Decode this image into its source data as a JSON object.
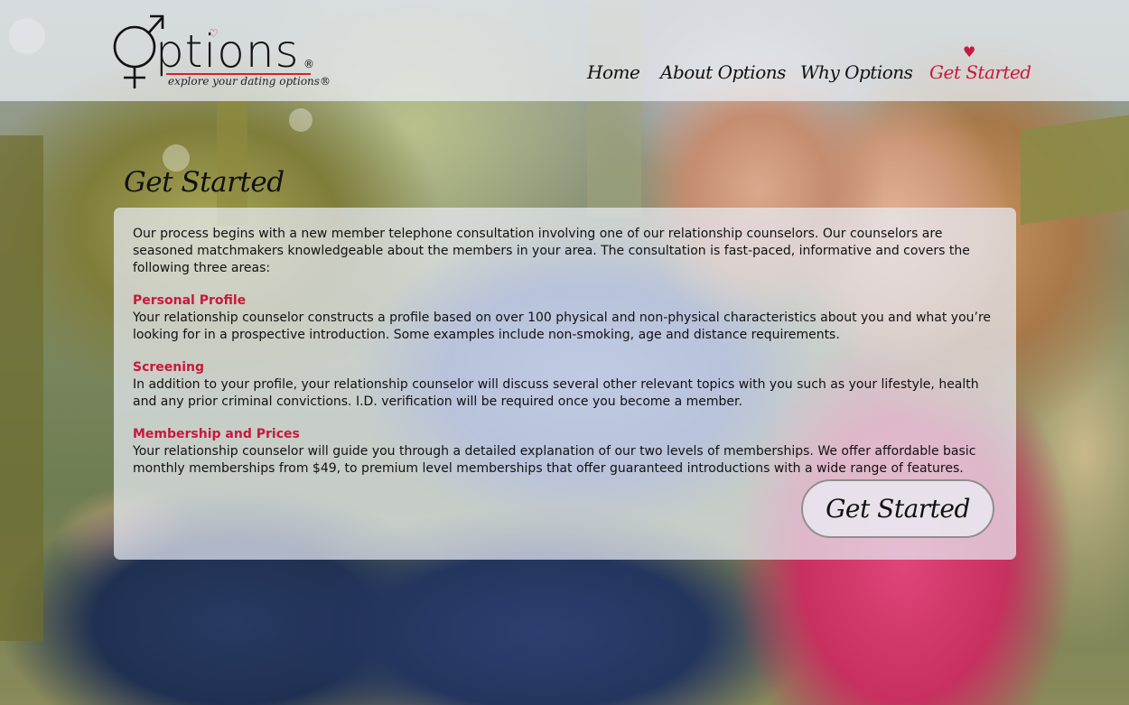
{
  "brand": {
    "name_prefix": "O",
    "name_rest": "ptions",
    "registered_mark": "®",
    "tagline": "explore your dating options®",
    "accent_color": "#c8183c"
  },
  "nav": {
    "items": [
      {
        "label": "Home",
        "active": false
      },
      {
        "label": "About Options",
        "active": false
      },
      {
        "label": "Why Options",
        "active": false
      },
      {
        "label": "Get Started",
        "active": true
      }
    ],
    "active_icon": "heart-icon"
  },
  "page": {
    "title": "Get Started",
    "intro": "Our process begins with a new member telephone consultation involving one of our relationship counselors. Our counselors are seasoned matchmakers knowledgeable about the members in your area. The consultation is fast-paced, informative and covers the following three areas:",
    "sections": [
      {
        "heading": "Personal Profile",
        "body": "Your relationship counselor constructs a profile based on over 100 physical and non-physical characteristics about you and what you’re looking for in a prospective introduction. Some examples include non-smoking, age and distance requirements."
      },
      {
        "heading": "Screening",
        "body": "In addition to your profile, your relationship counselor will discuss several other relevant topics with you such as your lifestyle, health and any prior criminal convictions. I.D. verification will be required once you become a member."
      },
      {
        "heading": "Membership and Prices",
        "body": "Your relationship counselor will guide you through a detailed explanation of our two levels of memberships. We offer affordable basic monthly memberships from $49, to premium level memberships that offer guaranteed introductions with a wide range of features."
      }
    ],
    "cta_label": "Get Started"
  }
}
